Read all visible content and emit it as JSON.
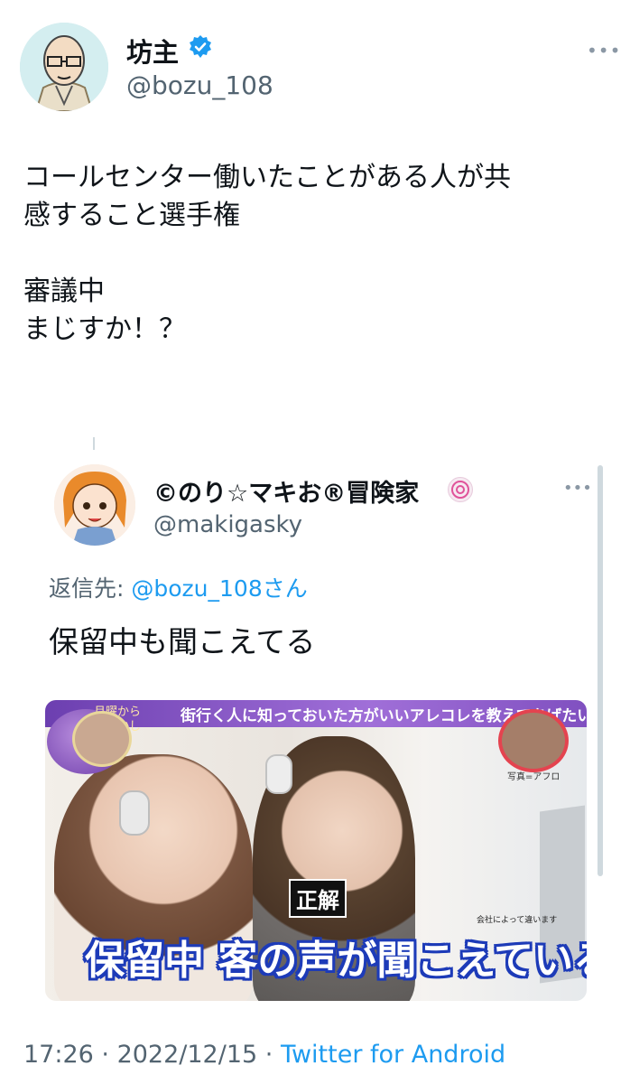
{
  "tweet": {
    "author_name": "坊主",
    "author_handle": "@bozu_108",
    "more_icon": "more-icon",
    "text": "コールセンター働いたことがある人が共\n感すること選手権\n\n審議中\nまじすか！？"
  },
  "reply": {
    "author_name": "©のり☆マキお®冒険家",
    "author_handle": "@makigasky",
    "reply_label": "返信先: ",
    "reply_to": "@bozu_108さん",
    "text": "保留中も聞こえてる",
    "image": {
      "banner": "街行く人に知っておいた方がいいアレコレを教えてあげたい件",
      "logo": "月曜から\n夜ふかし",
      "photo_credit": "写真=アフロ",
      "badge": "正解",
      "note": "会社によって違います",
      "caption_a": "保留中",
      "caption_b": "客の声が聞こえている"
    }
  },
  "footer": {
    "time": "17:26",
    "sep1": " · ",
    "date": "2022/12/15",
    "sep2": " · ",
    "source": "Twitter for Android"
  },
  "colors": {
    "link": "#1d9bf0",
    "secondary_text": "#536471",
    "verified": "#1d9bf0"
  }
}
